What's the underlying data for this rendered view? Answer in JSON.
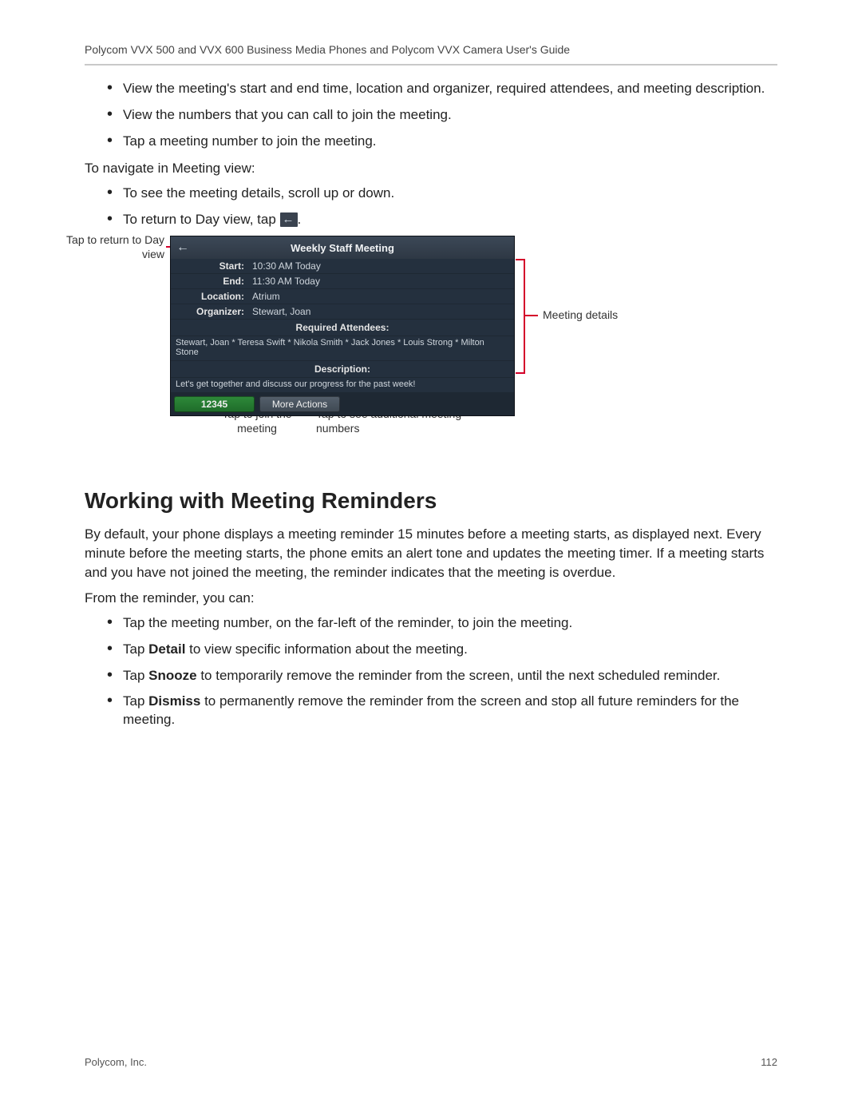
{
  "header": "Polycom VVX 500 and VVX 600 Business Media Phones and Polycom VVX Camera User's Guide",
  "topBullets": [
    "View the meeting's start and end time, location and organizer, required attendees, and meeting description.",
    "View the numbers that you can call to join the meeting.",
    "Tap a meeting number to join the meeting."
  ],
  "navIntro": "To navigate in Meeting view:",
  "navBullets": {
    "b1": "To see the meeting details, scroll up or down.",
    "b2_prefix": "To return to Day view, tap "
  },
  "callouts": {
    "backLabel": "Tap to return to Day view",
    "detailsLabel": "Meeting details",
    "joinLabel": "Tap to join the meeting",
    "moreLabel": "Tap to see additional meeting numbers"
  },
  "phone": {
    "title": "Weekly Staff Meeting",
    "fields": {
      "startLabel": "Start:",
      "startValue": "10:30 AM Today",
      "endLabel": "End:",
      "endValue": "11:30 AM Today",
      "locLabel": "Location:",
      "locValue": "Atrium",
      "orgLabel": "Organizer:",
      "orgValue": "Stewart, Joan"
    },
    "reqHead": "Required Attendees:",
    "attendees": "Stewart, Joan * Teresa Swift * Nikola Smith * Jack Jones * Louis Strong * Milton Stone",
    "descHead": "Description:",
    "description": "Let's get together and discuss our progress for the past week!",
    "softkeys": {
      "join": "12345",
      "more": "More Actions"
    }
  },
  "section": {
    "title": "Working with Meeting Reminders",
    "p1": "By default, your phone displays a meeting reminder 15 minutes before a meeting starts, as displayed next. Every minute before the meeting starts, the phone emits an alert tone and updates the meeting timer. If a meeting starts and you have not joined the meeting, the reminder indicates that the meeting is overdue.",
    "p2": "From the reminder, you can:",
    "bullets": {
      "b1": "Tap the meeting number, on the far-left of the reminder, to join the meeting.",
      "b2_prefix": "Tap ",
      "b2_bold": "Detail",
      "b2_suffix": " to view specific information about the meeting.",
      "b3_prefix": "Tap ",
      "b3_bold": "Snooze",
      "b3_suffix": " to temporarily remove the reminder from the screen, until the next scheduled reminder.",
      "b4_prefix": "Tap ",
      "b4_bold": "Dismiss",
      "b4_suffix": " to permanently remove the reminder from the screen and stop all future reminders for the meeting."
    }
  },
  "footer": {
    "company": "Polycom, Inc.",
    "page": "112"
  }
}
